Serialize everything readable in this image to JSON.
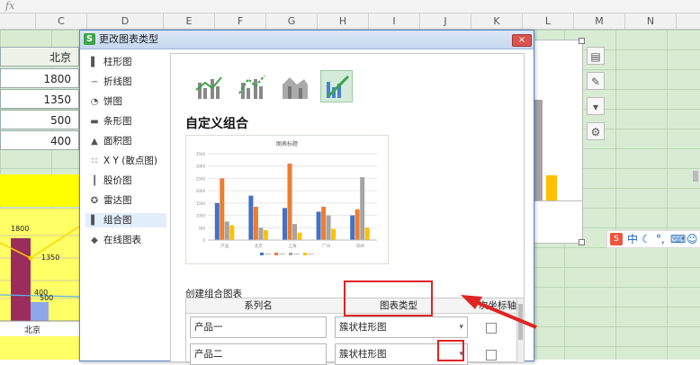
{
  "formula_bar": {
    "fx": "fx"
  },
  "columns": [
    "C",
    "D",
    "E",
    "F",
    "G",
    "H",
    "I",
    "J",
    "K",
    "L",
    "M",
    "N"
  ],
  "sheet": {
    "header_cell": "北京",
    "values": [
      "1800",
      "1350",
      "500",
      "400"
    ],
    "mini_chart": {
      "labels": [
        "1800",
        "1350",
        "400",
        "500"
      ],
      "category": "北京"
    }
  },
  "dialog": {
    "logo": "S",
    "title": "更改图表类型",
    "close": "×",
    "sidebar": [
      {
        "label": "柱形图",
        "icon": "bar-chart-icon"
      },
      {
        "label": "折线图",
        "icon": "line-chart-icon"
      },
      {
        "label": "饼图",
        "icon": "pie-chart-icon"
      },
      {
        "label": "条形图",
        "icon": "horizontal-bar-icon"
      },
      {
        "label": "面积图",
        "icon": "area-chart-icon"
      },
      {
        "label": "X Y (散点图)",
        "icon": "scatter-chart-icon"
      },
      {
        "label": "股价图",
        "icon": "stock-chart-icon"
      },
      {
        "label": "雷达图",
        "icon": "radar-chart-icon"
      },
      {
        "label": "组合图",
        "icon": "combo-chart-icon",
        "selected": true
      },
      {
        "label": "在线图表",
        "icon": "online-chart-icon"
      }
    ],
    "custom_title": "自定义组合",
    "preview": {
      "title": "图表标题",
      "categories": [
        "产品",
        "北京",
        "上海",
        "广州",
        "深圳"
      ],
      "yticks": [
        "3500",
        "3000",
        "2500",
        "2000",
        "1500",
        "1000",
        "500",
        "0"
      ]
    },
    "create_label": "创建组合图表",
    "table": {
      "headers": {
        "series": "系列名",
        "type": "图表类型",
        "axis": "次坐标轴"
      },
      "rows": [
        {
          "name": "产品一",
          "type": "簇状柱形图"
        },
        {
          "name": "产品二",
          "type": "簇状柱形图"
        }
      ]
    }
  },
  "ime": {
    "label": "中"
  },
  "chart_data": {
    "type": "bar",
    "title": "图表标题",
    "categories": [
      "产品",
      "北京",
      "上海",
      "广州",
      "深圳"
    ],
    "ylim": [
      0,
      3500
    ],
    "series": [
      {
        "values": [
          1500,
          1800,
          1300,
          1150,
          1000
        ],
        "color": "#4472c4"
      },
      {
        "values": [
          2500,
          1350,
          3100,
          1350,
          1250
        ],
        "color": "#ed7d31"
      },
      {
        "values": [
          750,
          500,
          650,
          1000,
          2550
        ],
        "color": "#a5a5a5"
      },
      {
        "values": [
          600,
          400,
          300,
          450,
          500
        ],
        "color": "#ffc000"
      }
    ]
  }
}
